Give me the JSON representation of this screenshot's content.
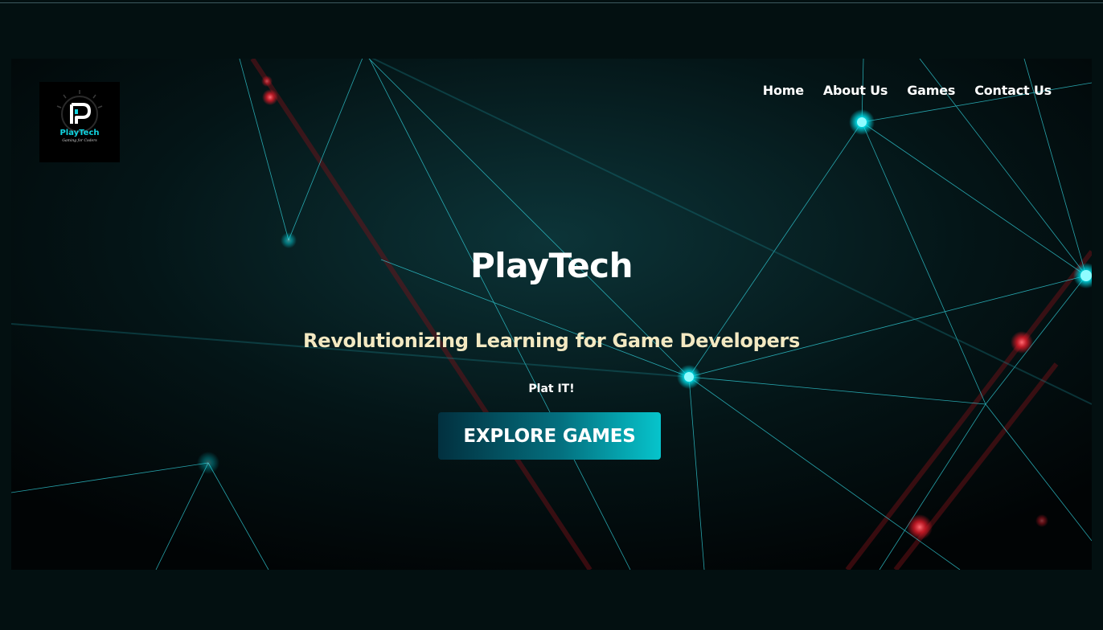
{
  "nav": {
    "items": [
      {
        "label": "Home"
      },
      {
        "label": "About Us"
      },
      {
        "label": "Games"
      },
      {
        "label": "Contact Us"
      }
    ]
  },
  "logo": {
    "text": "PlayTech",
    "tagline": "Gaming for Coders"
  },
  "hero": {
    "title": "PlayTech",
    "subtitle": "Revolutionizing Learning for Game Developers",
    "tagline": "Plat IT!",
    "cta_label": "EXPLORE GAMES"
  },
  "colors": {
    "background": "#031011",
    "accent_cyan": "#00e5f0",
    "accent_red": "#ff2b3a",
    "subtitle": "#f3e9c2",
    "button_start": "#02303f",
    "button_end": "#06c4cc"
  }
}
